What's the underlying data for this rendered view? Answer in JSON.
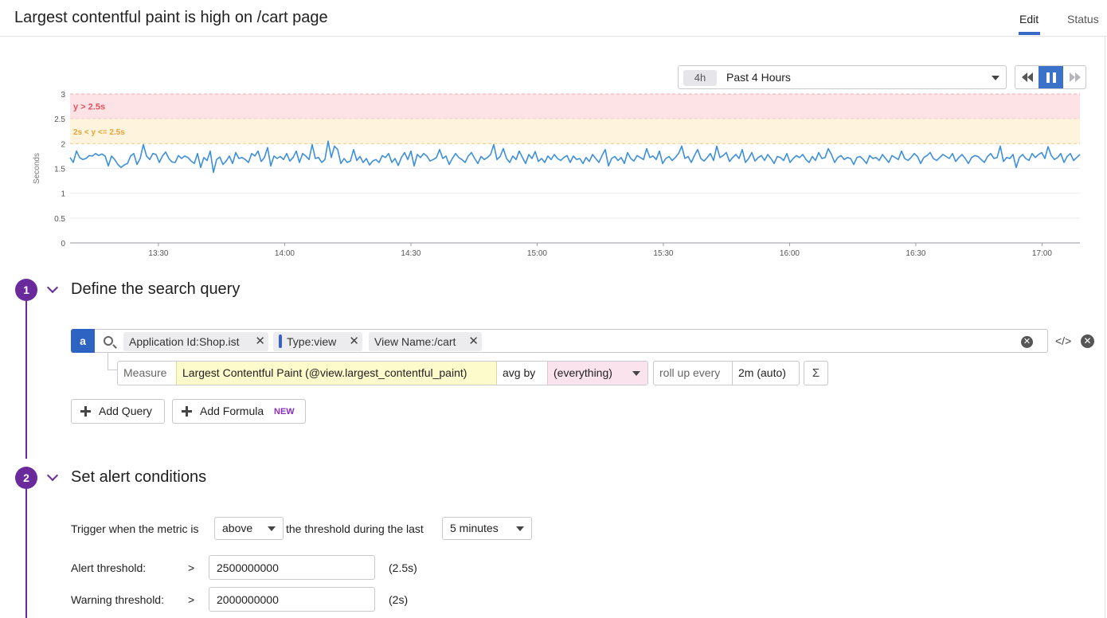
{
  "header": {
    "title": "Largest contentful paint is high on /cart page",
    "tabs": [
      {
        "label": "Edit",
        "active": true
      },
      {
        "label": "Status",
        "active": false
      }
    ]
  },
  "time_picker": {
    "badge": "4h",
    "label": "Past 4 Hours"
  },
  "playback": {
    "rewind_icon": "rewind-icon",
    "pause_icon": "pause-icon",
    "forward_icon": "fast-forward-icon"
  },
  "colors": {
    "accent": "#3a72c9",
    "step": "#6a2a9c",
    "line": "#3d8fdc",
    "alert_band": "#fde3e6",
    "warning_band": "#fef3dc",
    "alert_text": "#e2525f",
    "warning_text": "#e6a43b"
  },
  "chart_data": {
    "type": "line",
    "ylabel": "Seconds",
    "ylim": [
      0,
      3
    ],
    "yticks": [
      "0",
      "0.5",
      "1",
      "1.5",
      "2",
      "2.5",
      "3"
    ],
    "xticks": [
      "13:30",
      "14:00",
      "14:30",
      "15:00",
      "15:30",
      "16:00",
      "16:30",
      "17:00"
    ],
    "x_range": [
      "13:09",
      "17:09"
    ],
    "grid": true,
    "bands": [
      {
        "label": "y > 2.5s",
        "from": 2.5,
        "to": 3.0
      },
      {
        "label": "2s < y <= 2.5s",
        "from": 2.0,
        "to": 2.5
      }
    ],
    "series": [
      {
        "values": [
          1.72,
          1.62,
          1.85,
          1.72,
          1.68,
          1.7,
          1.76,
          1.75,
          1.8,
          1.76,
          1.79,
          1.75,
          1.55,
          1.75,
          1.68,
          1.58,
          1.52,
          1.57,
          1.6,
          1.75,
          1.8,
          1.58,
          1.7,
          1.98,
          1.75,
          1.68,
          1.8,
          1.78,
          1.62,
          1.75,
          1.83,
          1.7,
          1.63,
          1.62,
          1.76,
          1.7,
          1.75,
          1.72,
          1.65,
          1.6,
          1.8,
          1.52,
          1.72,
          1.66,
          1.85,
          1.42,
          1.68,
          1.73,
          1.58,
          1.65,
          1.75,
          1.6,
          1.82,
          1.7,
          1.72,
          1.68,
          1.62,
          1.8,
          1.75,
          1.85,
          1.64,
          1.72,
          1.92,
          1.55,
          1.75,
          1.7,
          1.74,
          1.68,
          1.8,
          1.65,
          1.72,
          1.85,
          1.62,
          1.8,
          1.75,
          1.68,
          1.98,
          1.7,
          1.72,
          1.62,
          1.68,
          2.05,
          1.72,
          1.95,
          1.88,
          1.6,
          1.7,
          1.62,
          1.65,
          1.88,
          1.66,
          1.74,
          1.62,
          1.7,
          1.57,
          1.65,
          1.68,
          1.62,
          1.76,
          1.72,
          1.8,
          1.62,
          1.7,
          1.56,
          1.72,
          1.82,
          1.68,
          1.85,
          1.55,
          1.78,
          1.72,
          1.8,
          1.75,
          1.65,
          1.68,
          1.72,
          1.88,
          1.7,
          1.75,
          1.58,
          1.7,
          1.8,
          1.72,
          1.68,
          1.62,
          1.75,
          1.82,
          1.7,
          1.6,
          1.74,
          1.68,
          1.72,
          1.78,
          1.98,
          1.68,
          1.74,
          1.9,
          1.7,
          1.62,
          1.75,
          1.68,
          1.85,
          1.72,
          1.6,
          1.78,
          1.7,
          1.84,
          1.64,
          1.7,
          1.62,
          1.75,
          1.68,
          1.78,
          1.7,
          1.66,
          1.72,
          1.76,
          1.62,
          1.75,
          1.68,
          1.7,
          1.6,
          1.72,
          1.64,
          1.78,
          1.7,
          1.62,
          1.76,
          1.88,
          1.55,
          1.7,
          1.74,
          1.66,
          1.72,
          1.6,
          1.82,
          1.7,
          1.65,
          1.76,
          1.72,
          1.68,
          1.9,
          1.72,
          1.75,
          1.68,
          1.85,
          1.6,
          1.7,
          1.74,
          1.66,
          1.72,
          1.8,
          1.95,
          1.7,
          1.74,
          1.62,
          1.76,
          1.88,
          1.7,
          1.65,
          1.72,
          1.8,
          1.66,
          1.95,
          1.72,
          1.76,
          1.82,
          1.64,
          1.72,
          1.78,
          1.7,
          1.88,
          1.62,
          1.7,
          1.82,
          1.65,
          1.72,
          1.76,
          1.66,
          1.78,
          1.7,
          1.6,
          1.74,
          1.72,
          1.66,
          1.8,
          1.62,
          1.7,
          1.76,
          1.72,
          1.78,
          1.68,
          1.62,
          1.74,
          1.66,
          1.82,
          1.7,
          1.72,
          1.9,
          1.78,
          1.62,
          1.72,
          1.76,
          1.68,
          1.72,
          1.7,
          1.58,
          1.72,
          1.74,
          1.68,
          1.6,
          1.76,
          1.7,
          1.72,
          1.66,
          1.78,
          1.7,
          1.62,
          1.76,
          1.72,
          1.68,
          1.85,
          1.7,
          1.66,
          1.72,
          1.8,
          1.74,
          1.6,
          1.72,
          1.76,
          1.82,
          1.7,
          1.66,
          1.72,
          1.78,
          1.74,
          1.7,
          1.8,
          1.64,
          1.72,
          1.78,
          1.7,
          1.6,
          1.72,
          1.76,
          1.74,
          1.68,
          1.62,
          1.74,
          1.8,
          1.7,
          1.72,
          1.95,
          1.64,
          1.72,
          1.7,
          1.78,
          1.52,
          1.72,
          1.78,
          1.7,
          1.66,
          1.8,
          1.72,
          1.78,
          1.82,
          1.7,
          1.94,
          1.76,
          1.68,
          1.72,
          1.8,
          1.62,
          1.74,
          1.8,
          1.66,
          1.72,
          1.78
        ]
      }
    ]
  },
  "step1": {
    "number": "1",
    "title": "Define the search query",
    "query": {
      "letter": "a",
      "tags": [
        "Application Id:Shop.ist",
        "Type:view",
        "View Name:/cart"
      ],
      "measure_label": "Measure",
      "measure_value": "Largest Contentful Paint (@view.largest_contentful_paint)",
      "aggregation": "avg by",
      "group_by": "(everything)",
      "rollup_label": "roll up every",
      "rollup_value": "2m (auto)",
      "sigma": "Σ"
    },
    "add_query": "Add Query",
    "add_formula": "Add Formula",
    "new_badge": "NEW"
  },
  "step2": {
    "number": "2",
    "title": "Set alert conditions",
    "trigger_prefix": "Trigger when the metric is",
    "trigger_op": "above",
    "trigger_mid": "the threshold during the last",
    "trigger_window": "5 minutes",
    "alert_label": "Alert threshold:",
    "alert_cmp": ">",
    "alert_value": "2500000000",
    "alert_human": "(2.5s)",
    "warning_label": "Warning threshold:",
    "warning_cmp": ">",
    "warning_value": "2000000000",
    "warning_human": "(2s)"
  }
}
